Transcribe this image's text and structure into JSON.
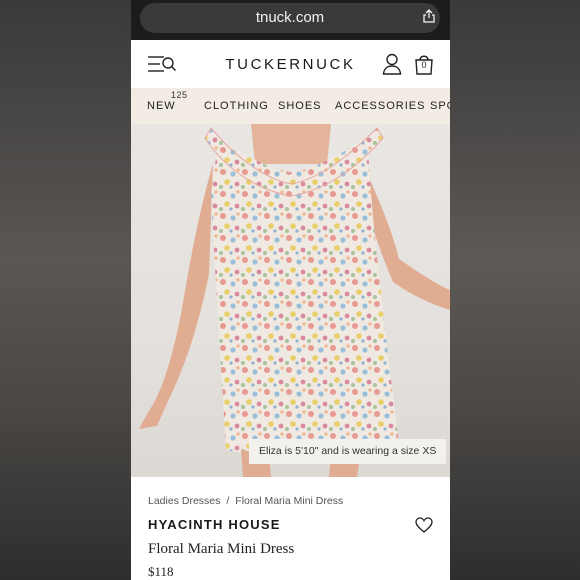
{
  "browser": {
    "url": "tnuck.com"
  },
  "header": {
    "logo": "TUCKERNUCK",
    "bag_count": "0"
  },
  "nav": {
    "items": [
      {
        "label": "NEW",
        "badge": "125"
      },
      {
        "label": "CLOTHING"
      },
      {
        "label": "SHOES"
      },
      {
        "label": "ACCESSORIES"
      },
      {
        "label": "SPO"
      }
    ]
  },
  "product": {
    "image_caption": "Eliza is 5'10\" and is wearing a size XS",
    "breadcrumb": [
      "Ladies Dresses",
      "Floral Maria Mini Dress"
    ],
    "breadcrumb_separator": "/",
    "brand": "HYACINTH HOUSE",
    "name": "Floral Maria Mini Dress",
    "price": "$118"
  },
  "colors": {
    "nav_bg": "#f2ece4",
    "browser_bg": "#1c1c1e",
    "url_pill": "#3a3a3c"
  }
}
